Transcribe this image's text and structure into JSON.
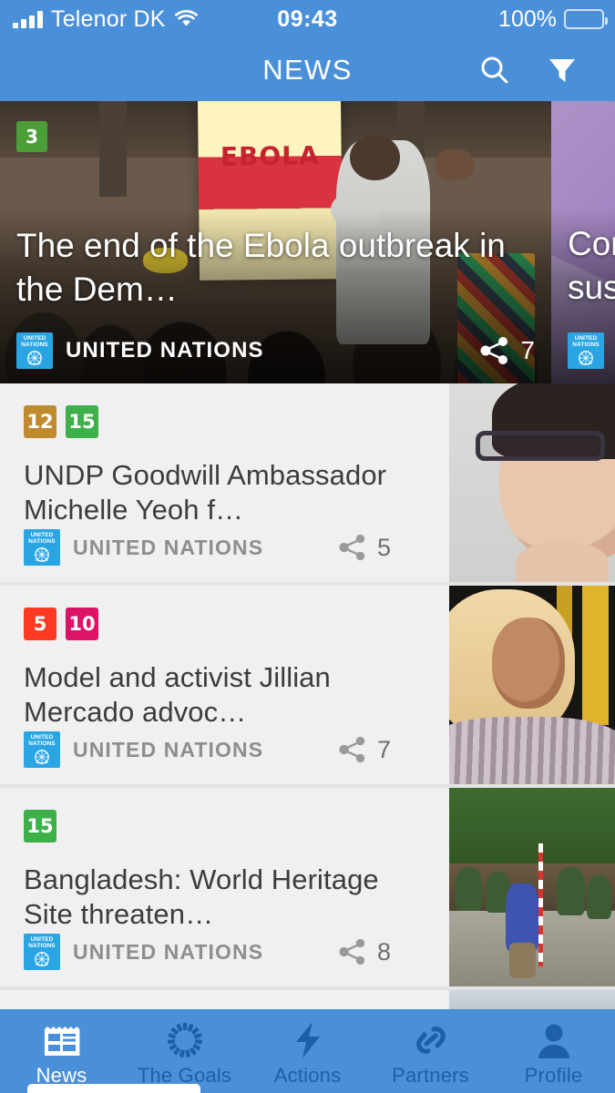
{
  "status_bar": {
    "carrier": "Telenor DK",
    "signal_icon": "signal-bars-icon",
    "wifi_icon": "wifi-icon",
    "time": "09:43",
    "battery_percent": "100%",
    "battery_icon": "battery-full-icon",
    "battery_color": "#ffcc00"
  },
  "app_bar": {
    "title": "NEWS",
    "search_icon": "search-icon",
    "filter_icon": "filter-icon",
    "background_color": "#4a90d9"
  },
  "hero": {
    "cards": [
      {
        "sdg_badges": [
          {
            "number": "3",
            "color": "#4C9F38"
          }
        ],
        "title": "The end of the Ebola outbreak in the Dem…",
        "source": "UNITED NATIONS",
        "source_logo": "un-logo-icon",
        "share_icon": "share-icon",
        "share_count": "7",
        "has_video": false
      },
      {
        "sdg_badges": [],
        "title_line1": "Cor",
        "title_line2": "sus",
        "source": "U",
        "source_logo": "un-logo-icon",
        "play_icon": "play-icon",
        "has_video": true
      }
    ]
  },
  "news_list": {
    "items": [
      {
        "sdg_badges": [
          {
            "number": "12",
            "color": "#BF8B2E"
          },
          {
            "number": "15",
            "color": "#3EB049"
          }
        ],
        "title": "UNDP Goodwill Ambassador Michelle Yeoh f…",
        "source": "UNITED NATIONS",
        "source_logo": "un-logo-icon",
        "share_icon": "share-icon",
        "share_count": "5",
        "thumbnail": "michelle-yeoh-thumbnail"
      },
      {
        "sdg_badges": [
          {
            "number": "5",
            "color": "#FF3A21"
          },
          {
            "number": "10",
            "color": "#DD1367"
          }
        ],
        "title": "Model and activist Jillian Mercado advoc…",
        "source": "UNITED NATIONS",
        "source_logo": "un-logo-icon",
        "share_icon": "share-icon",
        "share_count": "7",
        "thumbnail": "jillian-mercado-thumbnail"
      },
      {
        "sdg_badges": [
          {
            "number": "15",
            "color": "#3EB049"
          }
        ],
        "title": "Bangladesh: World Heritage Site threaten…",
        "source": "UNITED NATIONS",
        "source_logo": "un-logo-icon",
        "share_icon": "share-icon",
        "share_count": "8",
        "thumbnail": "bangladesh-heritage-thumbnail"
      }
    ]
  },
  "un_logo": {
    "line1": "UNITED",
    "line2": "NATIONS",
    "background_color": "#2aa5e4"
  },
  "bottom_nav": {
    "items": [
      {
        "label": "News",
        "icon": "newspaper-icon",
        "active": true
      },
      {
        "label": "The Goals",
        "icon": "sdg-wheel-icon",
        "active": false
      },
      {
        "label": "Actions",
        "icon": "lightning-bolt-icon",
        "active": false
      },
      {
        "label": "Partners",
        "icon": "chain-link-icon",
        "active": false
      },
      {
        "label": "Profile",
        "icon": "person-icon",
        "active": false
      }
    ],
    "active_color": "#ffffff",
    "inactive_color": "#1d5fa8"
  }
}
